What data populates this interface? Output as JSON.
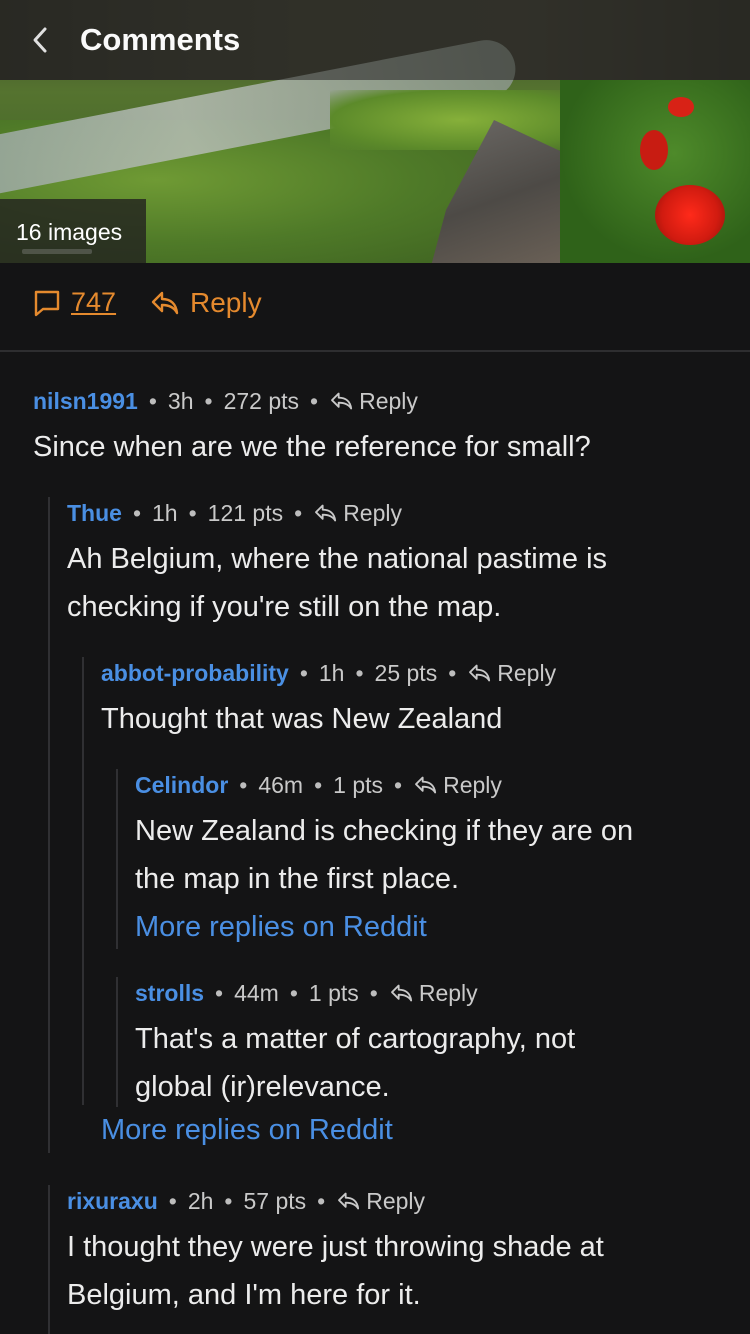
{
  "header": {
    "title": "Comments",
    "image_count_label": "16 images"
  },
  "post_actions": {
    "comment_count": "747",
    "reply_label": "Reply"
  },
  "comments": [
    {
      "author": "nilsn1991",
      "age": "3h",
      "points": "272 pts",
      "reply_label": "Reply",
      "lines": [
        "Since when are we the reference for small?"
      ]
    },
    {
      "author": "Thue",
      "age": "1h",
      "points": "121 pts",
      "reply_label": "Reply",
      "lines": [
        "Ah Belgium, where the national pastime is",
        "checking if you're still on the map."
      ]
    },
    {
      "author": "abbot-probability",
      "age": "1h",
      "points": "25 pts",
      "reply_label": "Reply",
      "lines": [
        "Thought that was New Zealand"
      ]
    },
    {
      "author": "Celindor",
      "age": "46m",
      "points": "1 pts",
      "reply_label": "Reply",
      "lines": [
        "New Zealand is checking if they are on",
        "the map in the first place."
      ],
      "more_label": "More replies on Reddit"
    },
    {
      "author": "strolls",
      "age": "44m",
      "points": "1 pts",
      "reply_label": "Reply",
      "lines": [
        "That's a matter of cartography, not",
        "global (ir)relevance."
      ]
    },
    {
      "author": "rixuraxu",
      "age": "2h",
      "points": "57 pts",
      "reply_label": "Reply",
      "lines": [
        "I thought they were just throwing shade at",
        "Belgium, and I'm here for it."
      ]
    }
  ],
  "thread_more_label": "More replies on Reddit",
  "colors": {
    "background": "#141415",
    "author_link": "#4a8fe3",
    "accent_orange": "#e58a2e"
  }
}
